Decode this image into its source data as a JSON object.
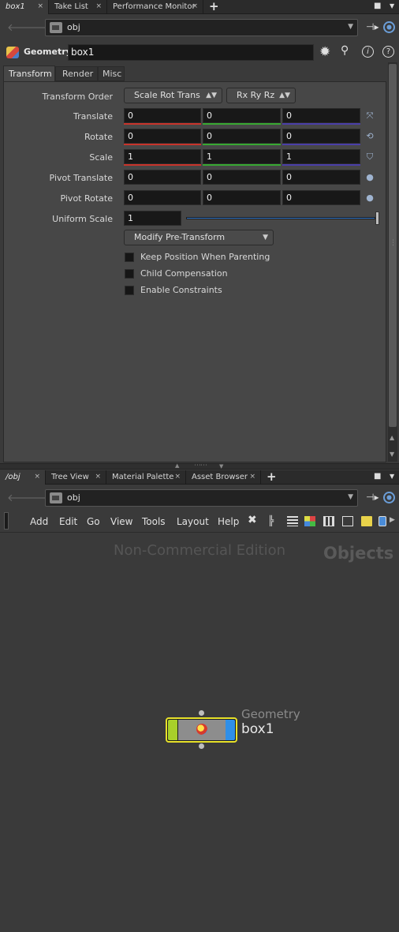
{
  "top_tabs": [
    {
      "label": "box1",
      "active": true
    },
    {
      "label": "Take List",
      "active": false
    },
    {
      "label": "Performance Monitor",
      "active": false
    }
  ],
  "top_path": "obj",
  "node_header": {
    "type_label": "Geometry",
    "name": "box1"
  },
  "param_tabs": [
    "Transform",
    "Render",
    "Misc"
  ],
  "transform_order": {
    "label": "Transform Order",
    "value1": "Scale Rot Trans",
    "value2": "Rx Ry Rz"
  },
  "params": [
    {
      "label": "Translate",
      "values": [
        "0",
        "0",
        "0"
      ]
    },
    {
      "label": "Rotate",
      "values": [
        "0",
        "0",
        "0"
      ]
    },
    {
      "label": "Scale",
      "values": [
        "1",
        "1",
        "1"
      ]
    },
    {
      "label": "Pivot Translate",
      "values": [
        "0",
        "0",
        "0"
      ]
    },
    {
      "label": "Pivot Rotate",
      "values": [
        "0",
        "0",
        "0"
      ]
    }
  ],
  "uniform_scale": {
    "label": "Uniform Scale",
    "value": "1"
  },
  "modify_button": "Modify Pre-Transform",
  "checkboxes": [
    "Keep Position When Parenting",
    "Child Compensation",
    "Enable Constraints"
  ],
  "bottom_tabs": [
    {
      "label": "/obj",
      "active": true
    },
    {
      "label": "Tree View",
      "active": false
    },
    {
      "label": "Material Palette",
      "active": false
    },
    {
      "label": "Asset Browser",
      "active": false
    }
  ],
  "bottom_path": "obj",
  "menus": [
    "Add",
    "Edit",
    "Go",
    "View",
    "Tools",
    "Layout",
    "Help"
  ],
  "network": {
    "watermark": "Non-Commercial Edition",
    "context_label": "Objects",
    "node_type": "Geometry",
    "node_name": "box1"
  },
  "colors": {
    "x_axis": "#c8342b",
    "y_axis": "#38a832",
    "z_axis": "#4a3fa8",
    "node_green": "#a8d02a",
    "node_blue": "#2f8fe8",
    "selected_outline": "#e8e22a"
  }
}
